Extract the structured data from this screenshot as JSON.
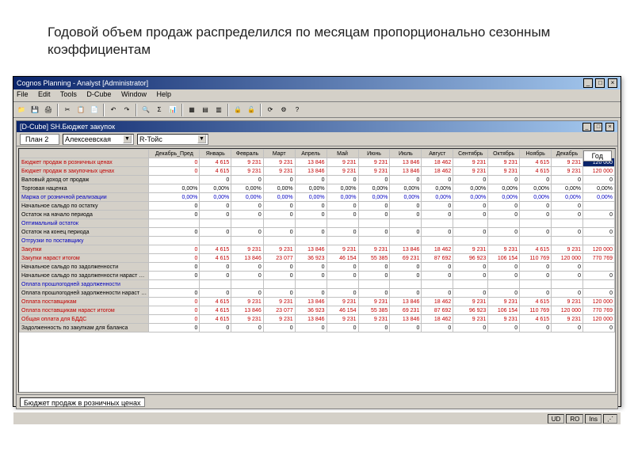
{
  "slide": {
    "title": "Годовой объем продаж распределился по месяцам пропорционально сезонным коэффициентам"
  },
  "app": {
    "title": "Cognos Planning - Analyst [Administrator]",
    "menu": {
      "file": "File",
      "edit": "Edit",
      "tools": "Tools",
      "dcube": "D-Cube",
      "window": "Window",
      "help": "Help"
    }
  },
  "inner": {
    "title": "[D-Cube] SH.Бюджет закупок",
    "tab": "План 2",
    "sel1": "Алексеевская",
    "sel2": "R-Тойс",
    "year_tab": "Год"
  },
  "status": {
    "field": "Бюджет продаж в розничных ценах",
    "ud": "UD",
    "ro": "RO",
    "ins": "Ins"
  },
  "chart_data": {
    "type": "table",
    "columns": [
      "Декабрь_Пред",
      "Январь",
      "Февраль",
      "Март",
      "Апрель",
      "Май",
      "Июнь",
      "Июль",
      "Август",
      "Сентябрь",
      "Октябрь",
      "Ноябрь",
      "Декабрь",
      "Год"
    ],
    "rows": [
      {
        "label": "Бюджет продаж в розничных ценах",
        "cls": "red",
        "hlLast": true,
        "vals": [
          "0",
          "4 615",
          "9 231",
          "9 231",
          "13 846",
          "9 231",
          "9 231",
          "13 846",
          "18 462",
          "9 231",
          "9 231",
          "4 615",
          "9 231",
          "120 000"
        ]
      },
      {
        "label": "Бюджет продаж в закупочных ценах",
        "cls": "red",
        "vals": [
          "0",
          "4 615",
          "9 231",
          "9 231",
          "13 846",
          "9 231",
          "9 231",
          "13 846",
          "18 462",
          "9 231",
          "9 231",
          "4 615",
          "9 231",
          "120 000"
        ]
      },
      {
        "label": "Валовый доход от продаж",
        "cls": "",
        "vals": [
          "",
          "0",
          "0",
          "0",
          "0",
          "0",
          "0",
          "0",
          "0",
          "0",
          "0",
          "0",
          "0",
          "0"
        ]
      },
      {
        "label": "Торговая наценка",
        "cls": "",
        "vals": [
          "0,00%",
          "0,00%",
          "0,00%",
          "0,00%",
          "0,00%",
          "0,00%",
          "0,00%",
          "0,00%",
          "0,00%",
          "0,00%",
          "0,00%",
          "0,00%",
          "0,00%",
          "0,00%"
        ]
      },
      {
        "label": "Маржа от розничной реализации",
        "cls": "blue",
        "vals": [
          "0,00%",
          "0,00%",
          "0,00%",
          "0,00%",
          "0,00%",
          "0,00%",
          "0,00%",
          "0,00%",
          "0,00%",
          "0,00%",
          "0,00%",
          "0,00%",
          "0,00%",
          "0,00%"
        ]
      },
      {
        "label": "Начальное сальдо по остатку",
        "cls": "",
        "vals": [
          "0",
          "0",
          "0",
          "0",
          "0",
          "0",
          "0",
          "0",
          "0",
          "0",
          "0",
          "0",
          "0",
          ""
        ]
      },
      {
        "label": "Остаток на начало периода",
        "cls": "",
        "vals": [
          "0",
          "0",
          "0",
          "0",
          "0",
          "0",
          "0",
          "0",
          "0",
          "0",
          "0",
          "0",
          "0",
          "0"
        ]
      },
      {
        "label": "Оптимальный остаток",
        "cls": "blue",
        "vals": [
          "",
          "",
          "",
          "",
          "",
          "",
          "",
          "",
          "",
          "",
          "",
          "",
          "",
          ""
        ]
      },
      {
        "label": "Остаток на конец периода",
        "cls": "",
        "vals": [
          "0",
          "0",
          "0",
          "0",
          "0",
          "0",
          "0",
          "0",
          "0",
          "0",
          "0",
          "0",
          "0",
          "0"
        ]
      },
      {
        "label": "Отгрузки по поставщику",
        "cls": "blue",
        "vals": [
          "",
          "",
          "",
          "",
          "",
          "",
          "",
          "",
          "",
          "",
          "",
          "",
          "",
          ""
        ]
      },
      {
        "label": "Закупки",
        "cls": "red",
        "vals": [
          "0",
          "4 615",
          "9 231",
          "9 231",
          "13 846",
          "9 231",
          "9 231",
          "13 846",
          "18 462",
          "9 231",
          "9 231",
          "4 615",
          "9 231",
          "120 000"
        ]
      },
      {
        "label": "Закупки нараст итогом",
        "cls": "red",
        "vals": [
          "0",
          "4 615",
          "13 846",
          "23 077",
          "36 923",
          "46 154",
          "55 385",
          "69 231",
          "87 692",
          "96 923",
          "106 154",
          "110 769",
          "120 000",
          "770 769"
        ]
      },
      {
        "label": "Начальное сальдо по задолженности",
        "cls": "",
        "vals": [
          "0",
          "0",
          "0",
          "0",
          "0",
          "0",
          "0",
          "0",
          "0",
          "0",
          "0",
          "0",
          "0",
          ""
        ]
      },
      {
        "label": "Начальное сальдо по задолженности нараст итогом",
        "cls": "",
        "vals": [
          "0",
          "0",
          "0",
          "0",
          "0",
          "0",
          "0",
          "0",
          "0",
          "0",
          "0",
          "0",
          "0",
          "0"
        ]
      },
      {
        "label": "Оплата прошлогодней задолженности",
        "cls": "blue",
        "vals": [
          "",
          "",
          "",
          "",
          "",
          "",
          "",
          "",
          "",
          "",
          "",
          "",
          "",
          ""
        ]
      },
      {
        "label": "Оплата прошлогодней задолженности нараст итогом",
        "cls": "",
        "vals": [
          "0",
          "0",
          "0",
          "0",
          "0",
          "0",
          "0",
          "0",
          "0",
          "0",
          "0",
          "0",
          "0",
          "0"
        ]
      },
      {
        "label": "Оплата поставщикам",
        "cls": "red",
        "vals": [
          "0",
          "4 615",
          "9 231",
          "9 231",
          "13 846",
          "9 231",
          "9 231",
          "13 846",
          "18 462",
          "9 231",
          "9 231",
          "4 615",
          "9 231",
          "120 000"
        ]
      },
      {
        "label": "Оплата поставщикам нараст итогом",
        "cls": "red",
        "vals": [
          "0",
          "4 615",
          "13 846",
          "23 077",
          "36 923",
          "46 154",
          "55 385",
          "69 231",
          "87 692",
          "96 923",
          "106 154",
          "110 769",
          "120 000",
          "770 769"
        ]
      },
      {
        "label": "Общая оплата для БДДС",
        "cls": "red",
        "vals": [
          "0",
          "4 615",
          "9 231",
          "9 231",
          "13 846",
          "9 231",
          "9 231",
          "13 846",
          "18 462",
          "9 231",
          "9 231",
          "4 615",
          "9 231",
          "120 000"
        ]
      },
      {
        "label": "Задолженность по закупкам для баланса",
        "cls": "",
        "vals": [
          "0",
          "0",
          "0",
          "0",
          "0",
          "0",
          "0",
          "0",
          "0",
          "0",
          "0",
          "0",
          "0",
          "0"
        ]
      }
    ]
  }
}
